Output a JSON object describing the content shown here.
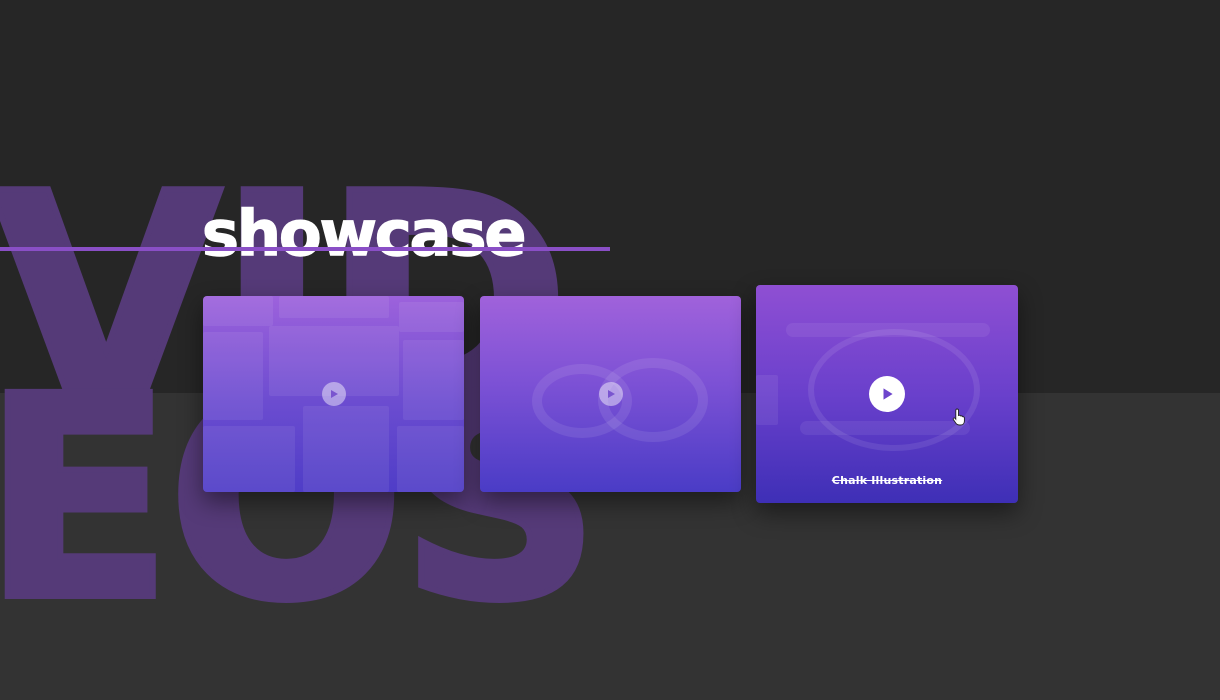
{
  "hero": {
    "background_word_line1": "VID",
    "background_word_line2": "EOS",
    "title": "showcase"
  },
  "cards": [
    {
      "label": "",
      "play_icon": "play-icon"
    },
    {
      "label": "",
      "play_icon": "play-icon"
    },
    {
      "label": "Chalk Illustration",
      "play_icon": "play-icon"
    }
  ],
  "colors": {
    "background_dark": "#262626",
    "background_lower": "#333333",
    "accent_purple": "#8a4fc6",
    "background_word": "#553a78"
  },
  "pointer_icon": "hand-pointer-icon"
}
